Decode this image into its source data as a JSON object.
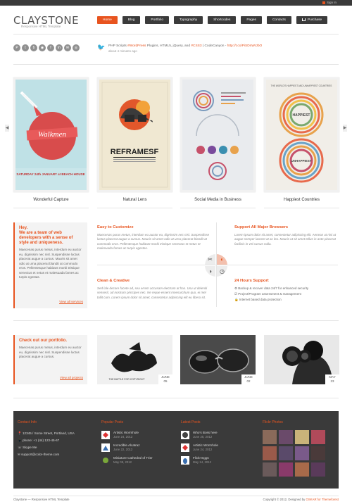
{
  "topbar": {
    "signin": "Sign In"
  },
  "header": {
    "logo": "CLAYSTONE",
    "tagline": "Responsive HTML Template",
    "nav": [
      "Home",
      "Blog",
      "Portfolio",
      "Typography",
      "Shortcodes",
      "Pages",
      "Contacts"
    ],
    "purchase": "Purchase"
  },
  "social": {
    "icons": [
      "P",
      "t",
      "b",
      "◉",
      "f",
      "in",
      "✉",
      "◎"
    ]
  },
  "tweet": {
    "text_a": "PHP Scripts ",
    "tag1": "#WordPress",
    "text_b": " Plugins, HTML5, jQuery, and ",
    "tag2": "#CSS3",
    "text_c": " | CodeCanyon - ",
    "link": "http://t.co/PiSDnWrJbO",
    "time": "about 4 minutes ago"
  },
  "slider": {
    "prev": "◀",
    "next": "▶",
    "items": [
      {
        "caption": "Wonderful Capture",
        "poster_title": "Walkmen",
        "poster_sub": "SATURDAY 24th JANUARY at ",
        "poster_sub_hl": "BEACH HOUSE"
      },
      {
        "caption": "Natural Lens",
        "poster_title": "REFRAMESF"
      },
      {
        "caption": "Social Media in Business"
      },
      {
        "caption": "Happiest Countries",
        "poster_title": "THE WORLD'S HAPPIEST AND UNHAPPIEST COUNTRIES",
        "label_a": "HAPPIEST",
        "label_b": "UNHAPPIEST"
      }
    ]
  },
  "about": {
    "heading_a": "Hey.",
    "heading_b": "We are a team of web developers with a sense of style and uniqueness.",
    "body": "Maecenas purus metus, interdum eu auctor eu, dignissim nec nisl. Suspendisse luctus placerat augue a cursus. Mauris sit amet odio at urna placerat blandit at commodo eros. Pellentesque habitant morbi tristique senectus et netus et malesuada fames ac turpis egestas.",
    "link": "View all services"
  },
  "features": {
    "f1_title": "Easy to Customize",
    "f1_body": "Maecenas purus metus, interdum eu auctor eu, dignissim nec nisl. Suspendisse luctus placerat augue a cursus. Mauris sit amet odio at urna placerat blandit at commodo eros. Pellentesque habitant morbi tristique senectus et netus et malesuada fames ac turpis egestas.",
    "f2_title": "Support All Major Browsers",
    "f2_body": "Lorem ipsum dolor sit amet, consectetur adipiscing elit. Aenean ut nisi ut augue semper laoreet at ac leo. Mauris ut sit amet tellus in ante placerat facilisis in vel cursus nulla.",
    "f3_title": "Clean & Creative",
    "f3_body": "Sed lale decore facete ad, sea errem accusam electram at has. Usu ut deleniti senserit, ad nostrum principes nec. Ne reque essent mnesarchum quo, ei mel tollit cum. Lorem ipsum dolor sit amet, consectetur adipiscing elit eu libero sit.",
    "f4_title": "24 Hours Support",
    "f4_items": [
      "Backup & recover data 24/7 for enhanced security",
      "Project/Program assessment & management",
      "Internet based data protection"
    ]
  },
  "portfolio": {
    "heading": "Check out our portfolio.",
    "body": "Maecenas purus metus, interdum eu auctor eu, dignissim nec nisl. Suspendisse luctus placerat augue a cursus.",
    "link": "View all projects",
    "items": [
      {
        "month": "JUNE",
        "day": "05",
        "label": "THE BATTLE FOR COPYRIGHT"
      },
      {
        "month": "JUNE",
        "day": "02"
      },
      {
        "month": "MAY",
        "day": "23"
      }
    ]
  },
  "footer": {
    "contact_title": "Contact Info",
    "address": "12345 / Some Street, Portland, USA",
    "phone": "phone: +1 (44) 123-45-67",
    "skype": "Skype Me",
    "email": "support@color-theme.com",
    "popular_title": "Popular Posts",
    "popular": [
      {
        "title": "Artistic Wormhole",
        "date": "June 24, 2012"
      },
      {
        "title": "Incredible Alcatraz",
        "date": "June 22, 2012"
      },
      {
        "title": "Miniature Cathedral of Trier",
        "date": "May 09, 2012"
      }
    ],
    "latest_title": "Latest Posts",
    "latest": [
      {
        "title": "Who's Boss here",
        "date": "June 25, 2012"
      },
      {
        "title": "Artistic Wormhole",
        "date": "June 24, 2012"
      },
      {
        "title": "Flickr Eggs",
        "date": "May 14, 2012"
      }
    ],
    "flickr_title": "Flickr Photos"
  },
  "bottom": {
    "left": "Claystone — Responsive HTML Template",
    "right_a": "Copyright © 2012, Designed by ",
    "right_b": "OSKAR",
    "right_c": " for Themeforest"
  },
  "colors": {
    "accent": "#e8541f",
    "dark": "#3a3a3a"
  }
}
